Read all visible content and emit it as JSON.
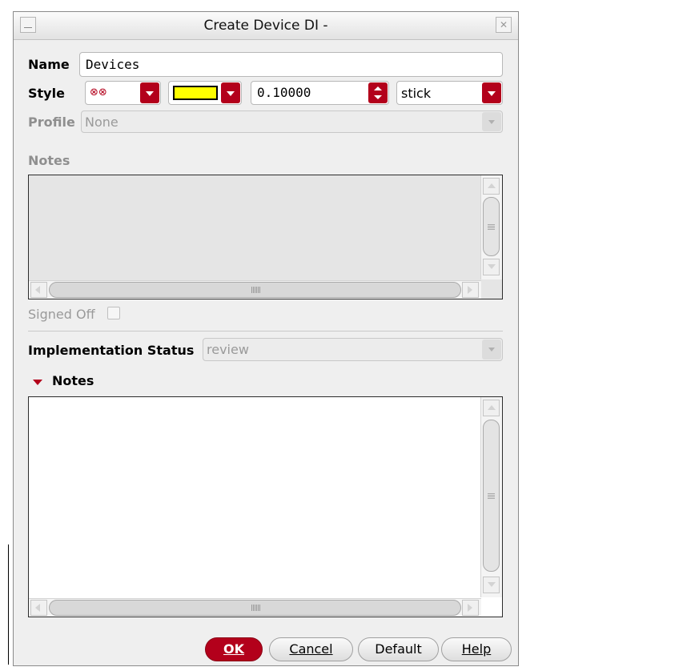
{
  "window": {
    "title": "Create Device DI -"
  },
  "name": {
    "label": "Name",
    "value": "Devices"
  },
  "style": {
    "label": "Style",
    "symbol": "⊗⊗",
    "color": "#ffff00",
    "width": "0.10000",
    "line_type": "stick"
  },
  "profile": {
    "label": "Profile",
    "value": "None"
  },
  "notes_section": {
    "label": "Notes"
  },
  "signed_off": {
    "label": "Signed Off"
  },
  "implementation": {
    "label": "Implementation Status",
    "value": "review"
  },
  "notes_expander": {
    "label": "Notes"
  },
  "buttons": {
    "ok": "OK",
    "cancel": "Cancel",
    "default": "Default",
    "help": "Help"
  },
  "colors": {
    "accent": "#b3001b"
  }
}
